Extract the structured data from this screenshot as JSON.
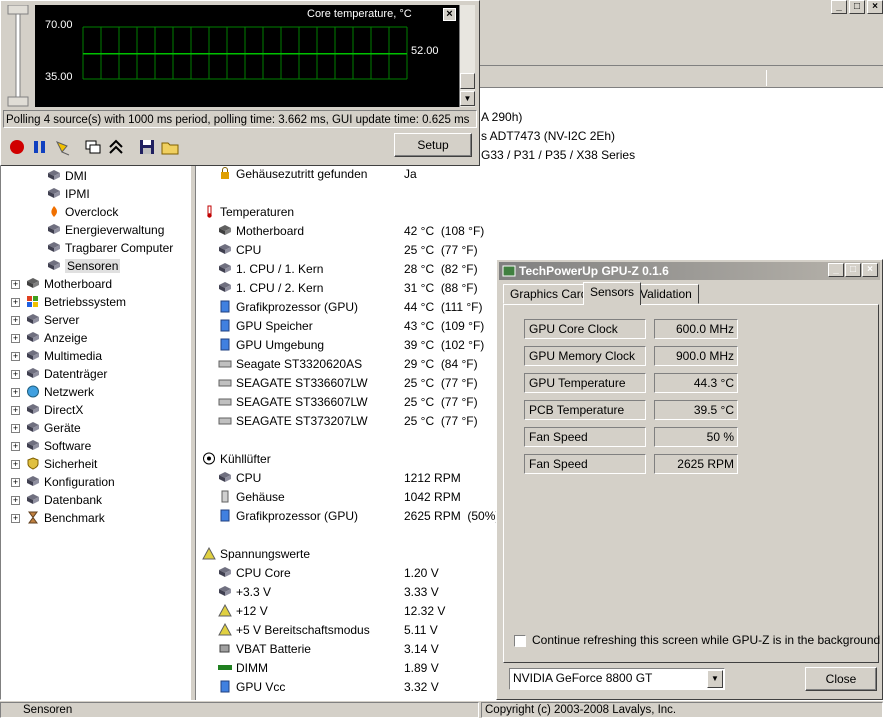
{
  "background_window": {
    "partial_rows": [
      "A 290h)",
      "s ADT7473  (NV-I2C 2Eh)",
      "G33 / P31 / P35 / X38 Series"
    ]
  },
  "tree": {
    "items": [
      {
        "label": "DMI",
        "level": 2,
        "icon": "dmi-icon"
      },
      {
        "label": "IPMI",
        "level": 2,
        "icon": "ipmi-icon"
      },
      {
        "label": "Overclock",
        "level": 2,
        "icon": "flame-icon"
      },
      {
        "label": "Energieverwaltung",
        "level": 2,
        "icon": "power-icon"
      },
      {
        "label": "Tragbarer Computer",
        "level": 2,
        "icon": "laptop-icon"
      },
      {
        "label": "Sensoren",
        "level": 2,
        "icon": "chip-icon",
        "selected": true
      },
      {
        "label": "Motherboard",
        "level": 1,
        "icon": "motherboard-icon"
      },
      {
        "label": "Betriebssystem",
        "level": 1,
        "icon": "windows-icon"
      },
      {
        "label": "Server",
        "level": 1,
        "icon": "server-icon"
      },
      {
        "label": "Anzeige",
        "level": 1,
        "icon": "monitor-icon"
      },
      {
        "label": "Multimedia",
        "level": 1,
        "icon": "speaker-icon"
      },
      {
        "label": "Datenträger",
        "level": 1,
        "icon": "disk-icon"
      },
      {
        "label": "Netzwerk",
        "level": 1,
        "icon": "globe-icon"
      },
      {
        "label": "DirectX",
        "level": 1,
        "icon": "directx-icon"
      },
      {
        "label": "Geräte",
        "level": 1,
        "icon": "devices-icon"
      },
      {
        "label": "Software",
        "level": 1,
        "icon": "software-icon"
      },
      {
        "label": "Sicherheit",
        "level": 1,
        "icon": "shield-icon"
      },
      {
        "label": "Konfiguration",
        "level": 1,
        "icon": "config-icon"
      },
      {
        "label": "Datenbank",
        "level": 1,
        "icon": "database-icon"
      },
      {
        "label": "Benchmark",
        "level": 1,
        "icon": "hourglass-icon"
      }
    ]
  },
  "sensor_list": [
    {
      "type": "item",
      "label": "Gehäusezutritt gefunden",
      "value": "Ja",
      "icon": "lock-icon"
    },
    {
      "type": "section",
      "label": "Temperaturen",
      "icon": "thermometer-icon"
    },
    {
      "type": "item",
      "label": "Motherboard",
      "value": "42 °C  (108 °F)",
      "icon": "motherboard-icon"
    },
    {
      "type": "item",
      "label": "CPU",
      "value": "25 °C  (77 °F)",
      "icon": "cpu-icon"
    },
    {
      "type": "item",
      "label": "1. CPU / 1. Kern",
      "value": "28 °C  (82 °F)",
      "icon": "cpu-icon"
    },
    {
      "type": "item",
      "label": "1. CPU / 2. Kern",
      "value": "31 °C  (88 °F)",
      "icon": "cpu-icon"
    },
    {
      "type": "item",
      "label": "Grafikprozessor (GPU)",
      "value": "44 °C  (111 °F)",
      "icon": "gpu-icon"
    },
    {
      "type": "item",
      "label": "GPU Speicher",
      "value": "43 °C  (109 °F)",
      "icon": "gpu-icon"
    },
    {
      "type": "item",
      "label": "GPU Umgebung",
      "value": "39 °C  (102 °F)",
      "icon": "gpu-icon"
    },
    {
      "type": "item",
      "label": "Seagate ST3320620AS",
      "value": "29 °C  (84 °F)",
      "icon": "hdd-icon"
    },
    {
      "type": "item",
      "label": "SEAGATE ST336607LW",
      "value": "25 °C  (77 °F)",
      "icon": "hdd-icon"
    },
    {
      "type": "item",
      "label": "SEAGATE ST336607LW",
      "value": "25 °C  (77 °F)",
      "icon": "hdd-icon"
    },
    {
      "type": "item",
      "label": "SEAGATE ST373207LW",
      "value": "25 °C  (77 °F)",
      "icon": "hdd-icon"
    },
    {
      "type": "section",
      "label": "Kühllüfter",
      "icon": "fan-icon"
    },
    {
      "type": "item",
      "label": "CPU",
      "value": "1212 RPM",
      "icon": "cpu-icon"
    },
    {
      "type": "item",
      "label": "Gehäuse",
      "value": "1042 RPM",
      "icon": "case-icon"
    },
    {
      "type": "item",
      "label": "Grafikprozessor (GPU)",
      "value": "2625 RPM  (50%)",
      "icon": "gpu-icon"
    },
    {
      "type": "section",
      "label": "Spannungswerte",
      "icon": "voltage-icon"
    },
    {
      "type": "item",
      "label": "CPU Core",
      "value": "1.20 V",
      "icon": "cpu-icon"
    },
    {
      "type": "item",
      "label": "+3.3 V",
      "value": "3.33 V",
      "icon": "cpu-icon"
    },
    {
      "type": "item",
      "label": "+12 V",
      "value": "12.32 V",
      "icon": "voltage-icon"
    },
    {
      "type": "item",
      "label": "+5 V Bereitschaftsmodus",
      "value": "5.11 V",
      "icon": "voltage-icon"
    },
    {
      "type": "item",
      "label": "VBAT Batterie",
      "value": "3.14 V",
      "icon": "battery-icon"
    },
    {
      "type": "item",
      "label": "DIMM",
      "value": "1.89 V",
      "icon": "dimm-icon"
    },
    {
      "type": "item",
      "label": "GPU Vcc",
      "value": "3.32 V",
      "icon": "gpu-icon"
    }
  ],
  "sensor_window": {
    "graph_title": "Core temperature, °C",
    "y_top_label": "70.00",
    "y_bottom_label": "35.00",
    "current_value_label": "52.00",
    "polling_status": "Polling 4 source(s) with 1000 ms period, polling time: 3.662 ms, GUI update time: 0.625 ms",
    "setup_label": "Setup",
    "toolbar_icons": [
      "record-icon",
      "pause-icon",
      "pin-icon",
      "windows-icon",
      "collapse-icon",
      "save-icon",
      "folder-icon"
    ]
  },
  "chart_data": {
    "type": "line",
    "title": "Core temperature, °C",
    "ylim": [
      35.0,
      70.0
    ],
    "series": [
      {
        "values": [
          52.0,
          52.0,
          52.0,
          52.0,
          52.0,
          52.0,
          52.0,
          52.0,
          52.0,
          52.0,
          52.0,
          52.0,
          52.0,
          52.0,
          52.0,
          52.0,
          52.0,
          52.0,
          52.0,
          52.0
        ]
      }
    ],
    "grid": true,
    "line_color": "#00c000",
    "grid_color": "#008000"
  },
  "gpuz": {
    "title": "TechPowerUp GPU-Z 0.1.6",
    "tabs": [
      "Graphics Card",
      "Sensors",
      "Validation"
    ],
    "active_tab": "Sensors",
    "sensors": [
      {
        "label": "GPU Core Clock",
        "value": "600.0 MHz"
      },
      {
        "label": "GPU Memory Clock",
        "value": "900.0 MHz"
      },
      {
        "label": "GPU Temperature",
        "value": "44.3 °C"
      },
      {
        "label": "PCB Temperature",
        "value": "39.5 °C"
      },
      {
        "label": "Fan Speed",
        "value": "50 %"
      },
      {
        "label": "Fan Speed",
        "value": "2625 RPM"
      }
    ],
    "continue_refresh_label": "Continue refreshing this screen while GPU-Z is in the background",
    "continue_refresh_checked": false,
    "card_select": "NVIDIA GeForce 8800 GT",
    "close_label": "Close"
  },
  "status_bar": {
    "left": "Sensoren",
    "right": "Copyright (c) 2003-2008 Lavalys, Inc."
  }
}
